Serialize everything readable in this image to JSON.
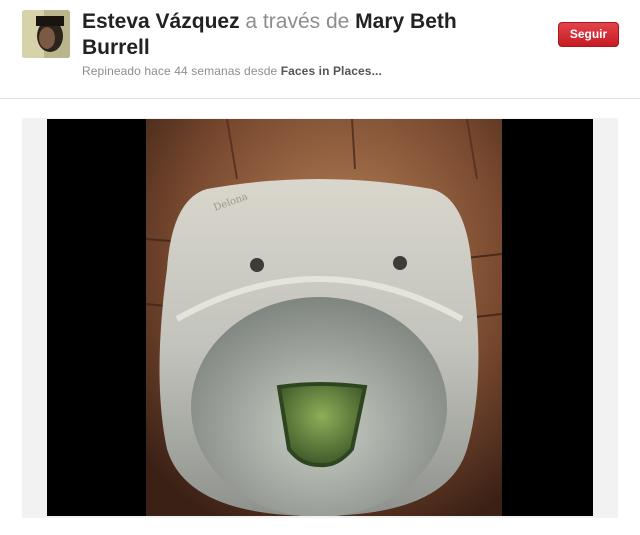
{
  "header": {
    "user_name": "Esteva Vázquez",
    "via": "a través de",
    "source_user": "Mary Beth Burrell",
    "subline_prefix": "Repineado hace 44 semanas desde",
    "board_name": "Faces in Places..."
  },
  "actions": {
    "follow_label": "Seguir"
  },
  "colors": {
    "follow_button": "#d3232b",
    "photo_border": "#000000"
  }
}
